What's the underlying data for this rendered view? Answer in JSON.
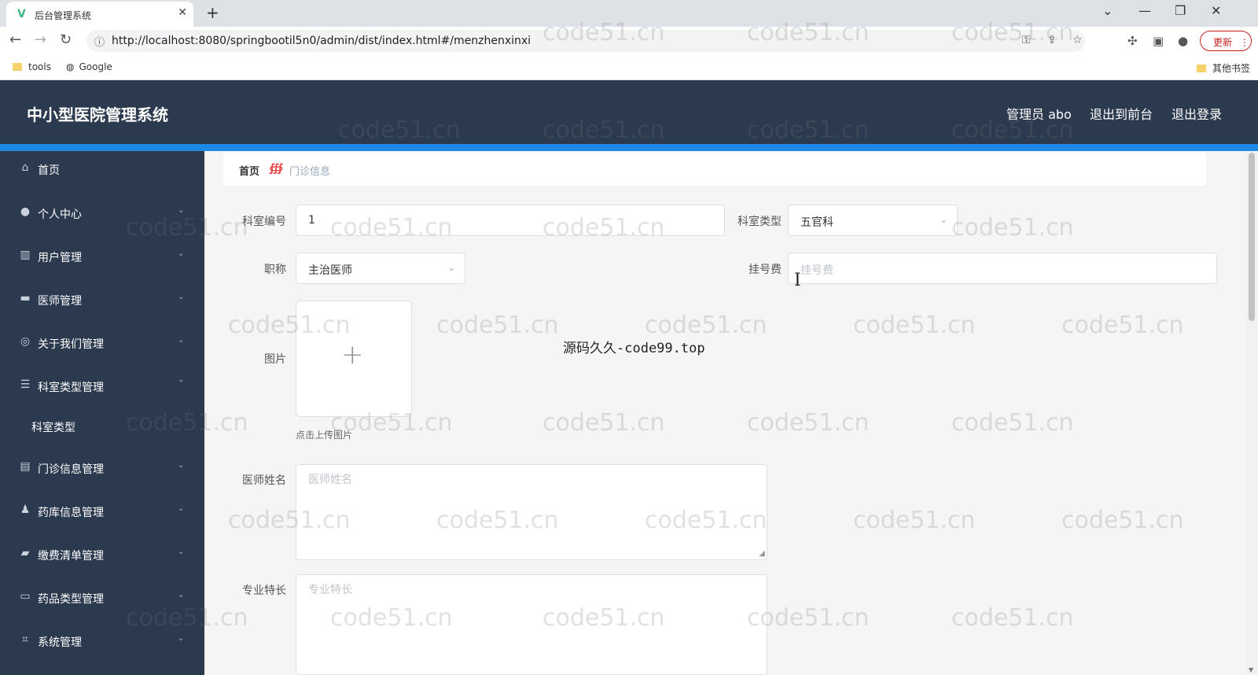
{
  "browser": {
    "tab_title": "后台管理系统",
    "tab_favicon": "V",
    "tab_close": "✕",
    "new_tab": "+",
    "url": "http://localhost:8080/springbootil5n0/admin/dist/index.html#/menzhenxinxi",
    "update_label": "更新",
    "bookmarks": [
      "tools",
      "Google"
    ],
    "other_bookmarks": "其他书签"
  },
  "app": {
    "title": "中小型医院管理系统",
    "header_links": [
      "管理员 abo",
      "退出到前台",
      "退出登录"
    ]
  },
  "sidebar": {
    "items": [
      {
        "label": "首页",
        "icon": "home-icon"
      },
      {
        "label": "个人中心",
        "icon": "user-icon"
      },
      {
        "label": "用户管理",
        "icon": "chart-icon"
      },
      {
        "label": "医师管理",
        "icon": "briefcase-icon"
      },
      {
        "label": "关于我们管理",
        "icon": "compass-icon"
      },
      {
        "label": "科室类型管理",
        "icon": "list-icon"
      },
      {
        "label": "科室类型",
        "icon": ""
      },
      {
        "label": "门诊信息管理",
        "icon": "clipboard-icon"
      },
      {
        "label": "药库信息管理",
        "icon": "person-icon"
      },
      {
        "label": "缴费清单管理",
        "icon": "message-icon"
      },
      {
        "label": "药品类型管理",
        "icon": "monitor-icon"
      },
      {
        "label": "系统管理",
        "icon": "crop-icon"
      }
    ]
  },
  "breadcrumb": {
    "home": "首页",
    "current": "门诊信息"
  },
  "form": {
    "dept_no_label": "科室编号",
    "dept_no_value": "1",
    "dept_type_label": "科室类型",
    "dept_type_value": "五官科",
    "title_label": "职称",
    "title_value": "主治医师",
    "fee_label": "挂号费",
    "fee_placeholder": "挂号费",
    "image_label": "图片",
    "upload_tip": "点击上传图片",
    "doctor_label": "医师姓名",
    "doctor_placeholder": "医师姓名",
    "specialty_label": "专业特长",
    "specialty_placeholder": "专业特长"
  },
  "overlay_text": "源码久久-code99.top",
  "watermark": "code51.cn",
  "colors": {
    "header_bg": "#2b3a4f",
    "accent_strip": "#1e88e5",
    "breadcrumb_sep": "#e23c3c"
  }
}
